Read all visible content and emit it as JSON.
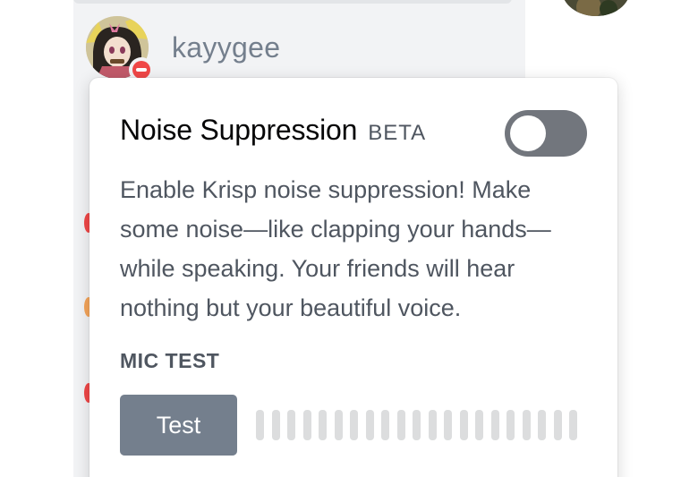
{
  "member_list": {
    "username": "kayygee"
  },
  "noise_popout": {
    "title": "Noise Suppression",
    "beta_badge": "BETA",
    "toggle_enabled": false,
    "description": "Enable Krisp noise suppression! Make some noise—like clapping your hands—while speaking. Your friends will hear nothing but your beautiful voice.",
    "mic_test_label": "MIC TEST",
    "test_button_label": "Test",
    "meter_level": 0
  },
  "colors": {
    "toggle_off": "#72767d",
    "test_button": "#747f8d",
    "dnd_status": "#f04747",
    "meter_inactive": "#dcddde"
  },
  "icons": {
    "status": "do-not-disturb-icon"
  }
}
